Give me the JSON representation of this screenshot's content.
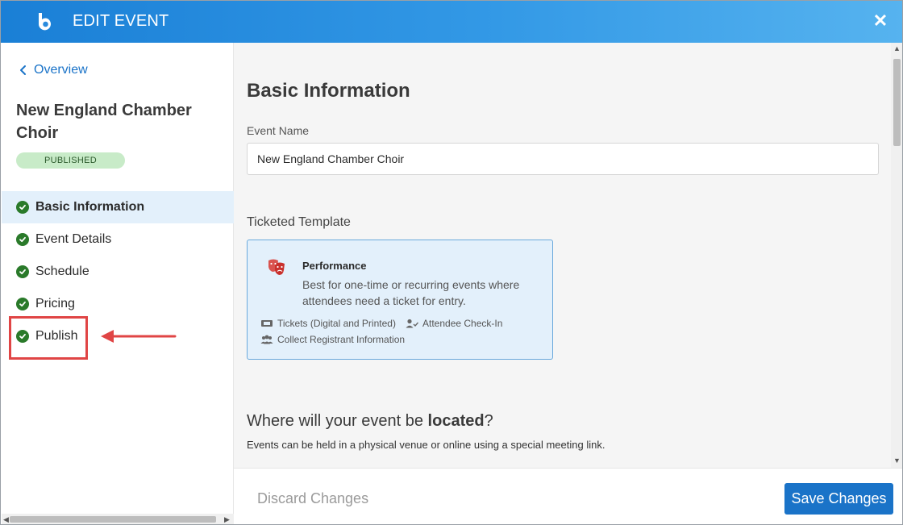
{
  "header": {
    "title": "EDIT EVENT",
    "logo_icon": "brand-b-logo-icon",
    "close_icon": "close-icon"
  },
  "sidebar": {
    "back_label": "Overview",
    "event_title": "New England Chamber Choir",
    "status": "PUBLISHED",
    "items": [
      {
        "label": "Basic Information",
        "active": true
      },
      {
        "label": "Event Details",
        "active": false
      },
      {
        "label": "Schedule",
        "active": false
      },
      {
        "label": "Pricing",
        "active": false
      },
      {
        "label": "Publish",
        "active": false
      }
    ]
  },
  "main": {
    "section_title": "Basic Information",
    "event_name_label": "Event Name",
    "event_name_value": "New England Chamber Choir",
    "template_label": "Ticketed Template",
    "template": {
      "title": "Performance",
      "description": "Best for one-time or recurring events where attendees need a ticket for entry.",
      "features": [
        "Tickets (Digital and Printed)",
        "Attendee Check-In",
        "Collect Registrant Information"
      ]
    },
    "location": {
      "title_prefix": "Where will your event be ",
      "title_bold": "located",
      "title_suffix": "?",
      "description": "Events can be held in a physical venue or online using a special meeting link."
    }
  },
  "footer": {
    "discard_label": "Discard Changes",
    "save_label": "Save Changes"
  },
  "colors": {
    "accent": "#1a73c8",
    "success": "#2a7a2a",
    "annotation": "#e04545"
  }
}
